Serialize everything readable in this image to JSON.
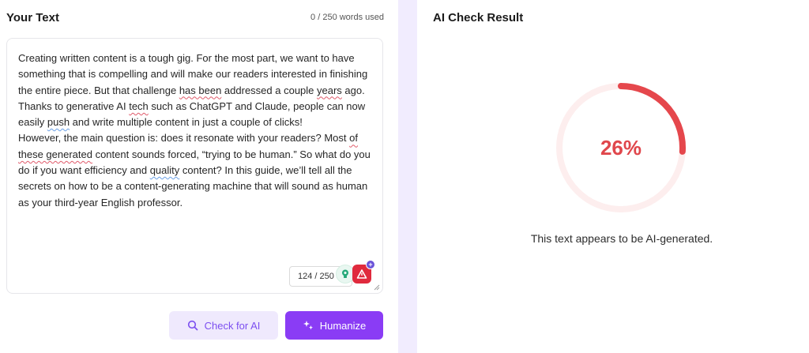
{
  "left": {
    "title": "Your Text",
    "word_usage": "0 / 250 words used",
    "editor": {
      "paragraphs": [
        [
          {
            "t": "Creating written content is a tough gig. For the most part, we want to have something that is compelling and will make our readers interested in finishing the entire piece. But that challenge "
          },
          {
            "t": "has been",
            "u": "red"
          },
          {
            "t": " addressed a couple "
          },
          {
            "t": "years",
            "u": "red"
          },
          {
            "t": " ago. Thanks to generative AI "
          },
          {
            "t": "tech",
            "u": "red"
          },
          {
            "t": " such as ChatGPT and Claude, people can now easily "
          },
          {
            "t": "push",
            "u": "blue"
          },
          {
            "t": " and write multiple content in just a couple of clicks!"
          }
        ],
        [
          {
            "t": "However, the main question is: does it resonate with your readers? Most "
          },
          {
            "t": "of these generated",
            "u": "red"
          },
          {
            "t": " content sounds forced, “trying to be human.” So what do you do if you want efficiency and "
          },
          {
            "t": "quality",
            "u": "blue"
          },
          {
            "t": " content? In this guide, we’ll tell all the secrets on how to be a content-generating machine that will sound as human as your third-year English professor."
          }
        ]
      ],
      "char_counter": "124 / 250"
    },
    "buttons": {
      "check": "Check for AI",
      "humanize": "Humanize"
    }
  },
  "right": {
    "title": "AI Check Result",
    "score_label": "26%",
    "score_fraction": 0.26,
    "message": "This text appears to be AI-generated."
  },
  "colors": {
    "accent": "#8a3cf5",
    "accent_light": "#efe9fd",
    "gauge_fill": "#e5474c",
    "gauge_track": "#fdeeee",
    "divider": "#f1ecfe"
  },
  "icons": {
    "check": "search-icon",
    "humanize": "sparkle-icon",
    "ext_green": "lightbulb-icon",
    "ext_red": "warning-icon"
  }
}
